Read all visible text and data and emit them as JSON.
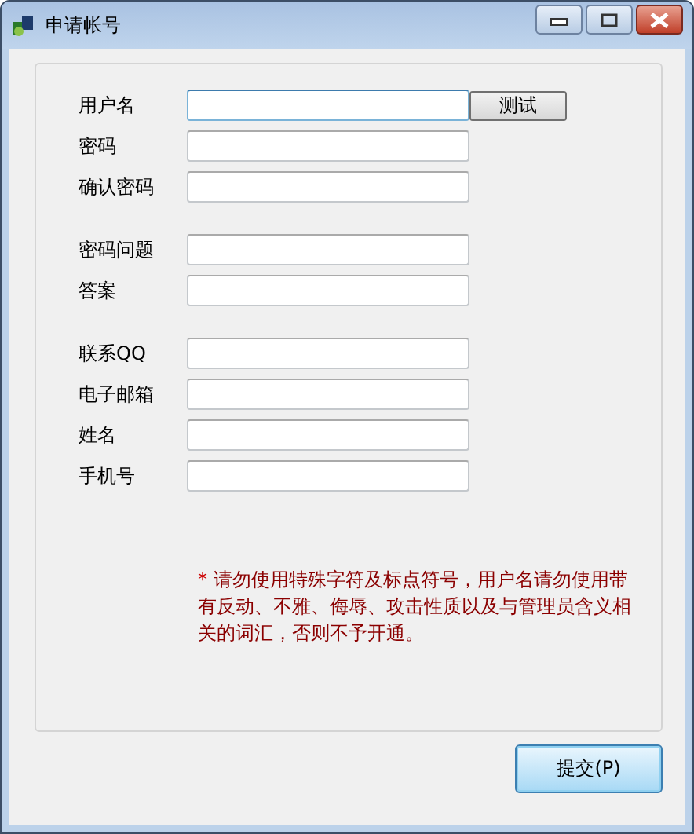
{
  "window": {
    "title": "申请帐号"
  },
  "groups": [
    {
      "fields": [
        {
          "label": "用户名",
          "focused": true,
          "button": "测试"
        },
        {
          "label": "密码",
          "focused": false
        },
        {
          "label": "确认密码",
          "focused": false
        }
      ]
    },
    {
      "fields": [
        {
          "label": "密码问题",
          "focused": false
        },
        {
          "label": "答案",
          "focused": false
        }
      ]
    },
    {
      "fields": [
        {
          "label": "联系QQ",
          "focused": false
        },
        {
          "label": "电子邮箱",
          "focused": false
        },
        {
          "label": "姓名",
          "focused": false
        },
        {
          "label": "手机号",
          "focused": false
        }
      ]
    }
  ],
  "note": {
    "mark": "*",
    "text": "请勿使用特殊字符及标点符号，用户名请勿使用带有反动、不雅、侮辱、攻击性质以及与管理员含义相关的词汇，否则不予开通。"
  },
  "submit": "提交(P)"
}
